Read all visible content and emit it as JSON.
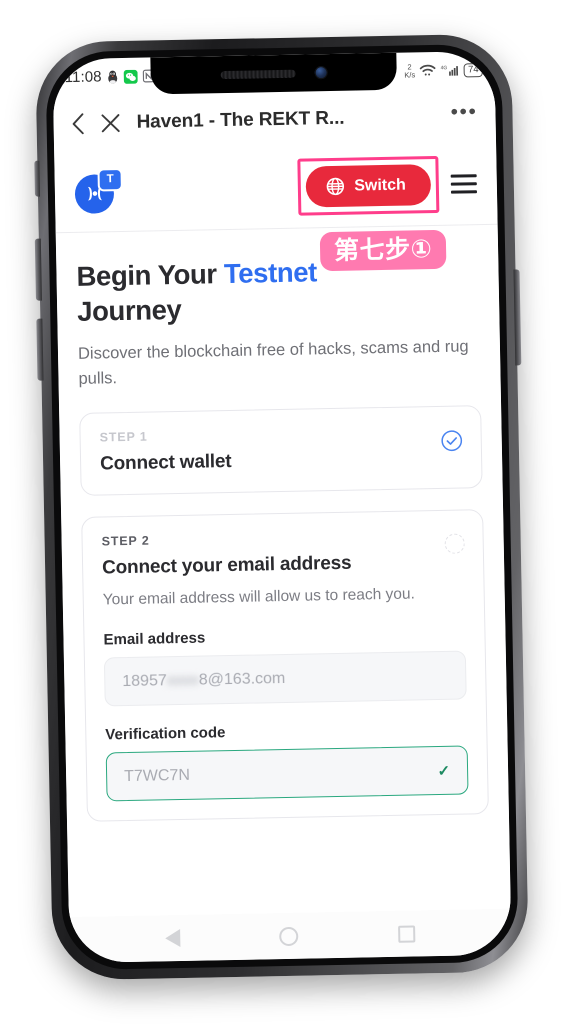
{
  "status_bar": {
    "clock": "11:08",
    "icons_left": [
      "qq-penguin-icon",
      "wechat-icon",
      "nfc-icon"
    ],
    "data_rate_value": "2",
    "data_rate_unit": "K/s",
    "icons_right": [
      "wifi-icon",
      "signal-4g-icon"
    ],
    "battery_level": "74"
  },
  "browser_header": {
    "back_icon": "chevron-left-icon",
    "close_icon": "close-x-icon",
    "title": "Haven1 - The REKT R...",
    "more_icon": "more-options-icon",
    "more_glyph": "•••"
  },
  "site_topbar": {
    "logo_name": "haven1-logo",
    "logo_badge_text": "T",
    "switch_button_label": "Switch",
    "switch_button_icon": "globe-icon",
    "menu_icon": "hamburger-menu-icon"
  },
  "annotation": {
    "step_badge_text": "第七步①",
    "highlight_color": "#ff3d8b",
    "badge_color": "#ff7ab0"
  },
  "content": {
    "headline_part1": "Begin Your ",
    "headline_accent": "Testnet",
    "headline_part2": "Journey",
    "subhead": "Discover the blockchain free of hacks, scams and rug pulls.",
    "steps": [
      {
        "label": "STEP 1",
        "title": "Connect wallet",
        "desc": "",
        "state": "complete",
        "marker_icon": "check-circle-icon"
      },
      {
        "label": "STEP 2",
        "title": "Connect your email address",
        "desc": "Your email address will allow us to reach you.",
        "state": "pending",
        "marker_icon": "empty-circle-icon",
        "fields": [
          {
            "label": "Email address",
            "value_prefix": "18957",
            "value_redacted": "xxxx",
            "value_suffix": "8@163.com",
            "state": "filled"
          },
          {
            "label": "Verification code",
            "value": "T7WC7N",
            "state": "valid",
            "check_icon": "check-icon"
          }
        ]
      }
    ]
  },
  "nav_bar": {
    "back_icon": "android-back-icon",
    "home_icon": "android-home-icon",
    "recents_icon": "android-recents-icon"
  },
  "colors": {
    "accent_blue": "#2f6ef0",
    "switch_red": "#e8293c",
    "valid_green": "#2aa87f",
    "annotation_pink": "#ff3d8b"
  }
}
